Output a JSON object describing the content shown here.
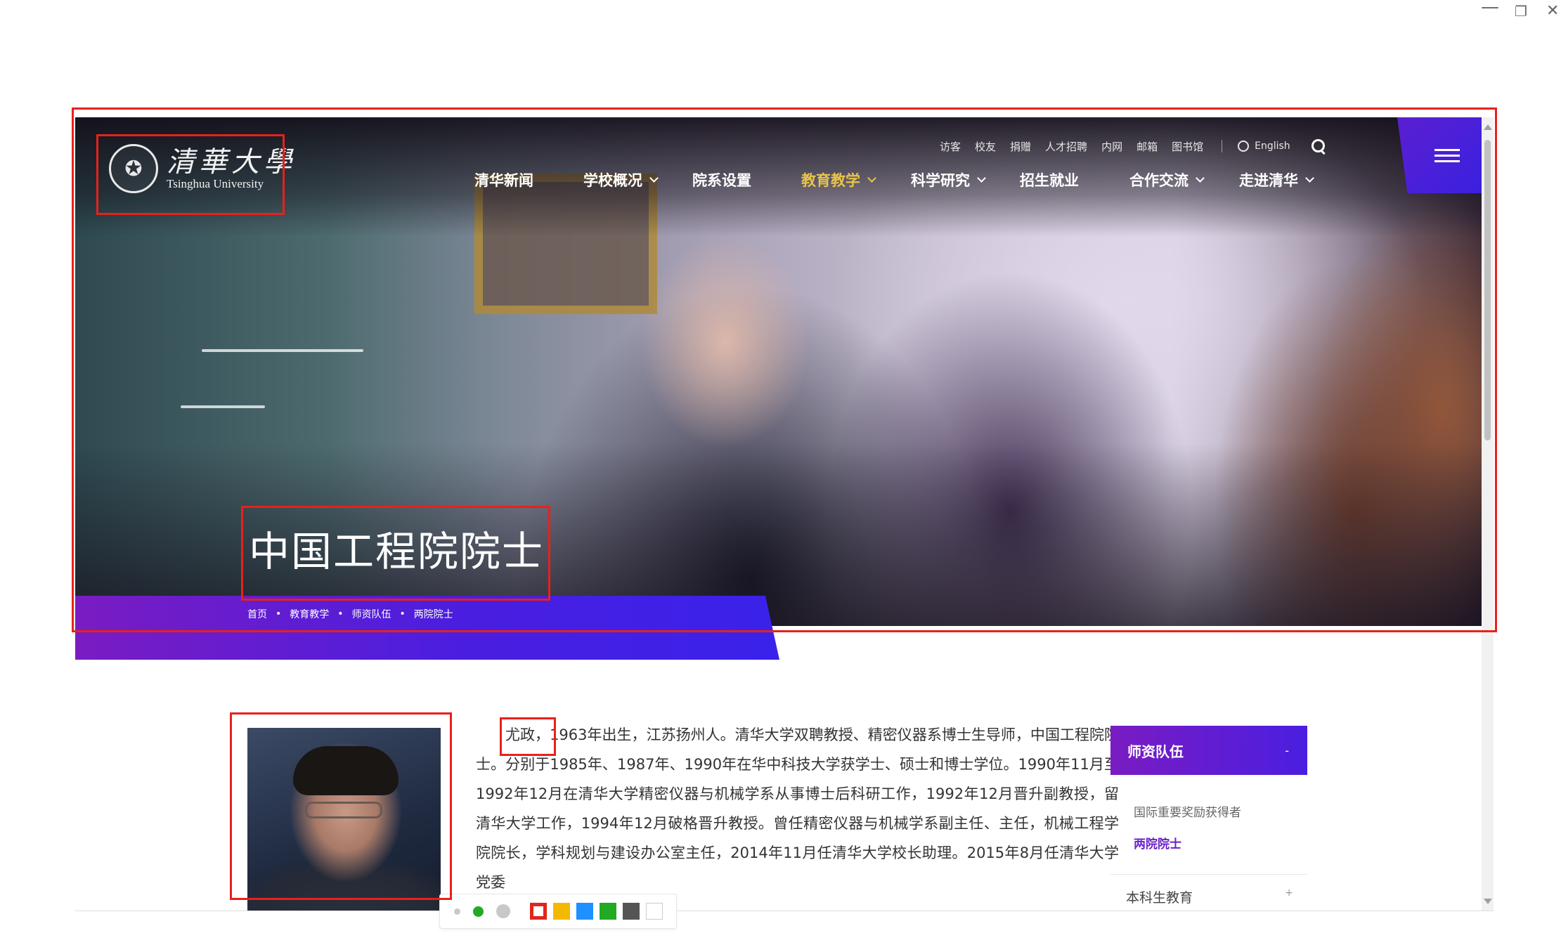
{
  "window_controls": {
    "minimize": "—",
    "maximize": "❐",
    "close": "✕"
  },
  "header": {
    "logo_cn": "清華大學",
    "logo_en": "Tsinghua University",
    "utility_links": [
      "访客",
      "校友",
      "捐赠",
      "人才招聘",
      "内网",
      "邮箱",
      "图书馆"
    ],
    "language": "English",
    "nav": [
      {
        "label": "清华新闻",
        "dropdown": false,
        "active": false
      },
      {
        "label": "学校概况",
        "dropdown": true,
        "active": false
      },
      {
        "label": "院系设置",
        "dropdown": false,
        "active": false
      },
      {
        "label": "教育教学",
        "dropdown": true,
        "active": true
      },
      {
        "label": "科学研究",
        "dropdown": true,
        "active": false
      },
      {
        "label": "招生就业",
        "dropdown": false,
        "active": false
      },
      {
        "label": "合作交流",
        "dropdown": true,
        "active": false
      },
      {
        "label": "走进清华",
        "dropdown": true,
        "active": false
      }
    ]
  },
  "hero": {
    "title": "中国工程院院士",
    "breadcrumb": [
      "首页",
      "教育教学",
      "师资队伍",
      "两院院士"
    ]
  },
  "bio": {
    "name": "尤政，",
    "text": "1963年出生，江苏扬州人。清华大学双聘教授、精密仪器系博士生导师，中国工程院院士。分别于1985年、1987年、1990年在华中科技大学获学士、硕士和博士学位。1990年11月至1992年12月在清华大学精密仪器与机械学系从事博士后科研工作，1992年12月晋升副教授，留清华大学工作，1994年12月破格晋升教授。曾任精密仪器与机械学系副主任、主任，机械工程学院院长，学科规划与建设办公室主任，2014年11月任清华大学校长助理。2015年8月任清华大学党委"
  },
  "sidebar": {
    "section_title": "师资队伍",
    "collapse_symbol": "-",
    "items": [
      {
        "label": "国际重要奖励获得者",
        "active": false
      },
      {
        "label": "两院院士",
        "active": true
      }
    ],
    "next_section": "本科生教育",
    "expand_symbol": "+"
  },
  "color_toolbar": {
    "dots": [
      "#c8c8c8",
      "#22aa22",
      "#c8c8c8"
    ],
    "swatches": [
      "#e0261c",
      "#f5b800",
      "#1e90ff",
      "#22aa22",
      "#555555",
      "#ffffff"
    ],
    "selected": "#e0261c"
  },
  "colors": {
    "purple": "#6b22c8",
    "blue_violet": "#3a22ea",
    "active_nav": "#e8c44a",
    "annotation_red": "#e8211a"
  }
}
